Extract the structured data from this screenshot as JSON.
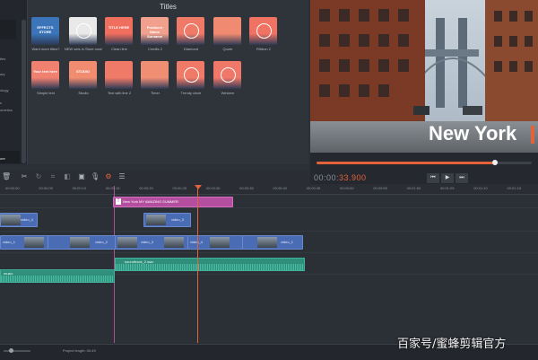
{
  "titles_panel": {
    "header": "Titles",
    "tiles": [
      {
        "label": "Want more titles?",
        "art_text": "EFFECTS STORE",
        "bg": "#3b74b8",
        "icon": "store-icon"
      },
      {
        "label": "NEW sets in Store now!",
        "art_text": "",
        "bg": "#e9e9e9",
        "icon": "badge-icon"
      },
      {
        "label": "Clean line",
        "art_text": "TITLE HERE",
        "bg": "#f06e5d",
        "icon": ""
      },
      {
        "label": "Credits 2",
        "art_text": "Producer Name Surname",
        "bg": "#f1a08e",
        "icon": ""
      },
      {
        "label": "Diamond",
        "art_text": "",
        "bg": "#f07a68",
        "icon": "diamond-icon"
      },
      {
        "label": "Quote",
        "art_text": "",
        "bg": "#f08a70",
        "icon": ""
      },
      {
        "label": "Ribbon 2",
        "art_text": "",
        "bg": "#f07262",
        "icon": "ribbon-icon"
      },
      {
        "label": "Simple text",
        "art_text": "Your text here",
        "bg": "#f08070",
        "icon": ""
      },
      {
        "label": "Studio",
        "art_text": "STUDIO",
        "bg": "#f18c70",
        "icon": ""
      },
      {
        "label": "Text with line 2",
        "art_text": "",
        "bg": "#f07a68",
        "icon": ""
      },
      {
        "label": "Timer",
        "art_text": "",
        "bg": "#f08e74",
        "icon": ""
      },
      {
        "label": "Trendy circle",
        "art_text": "",
        "bg": "#f07a68",
        "icon": "circle-icon"
      },
      {
        "label": "Western",
        "art_text": "",
        "bg": "#f07868",
        "icon": "badge-icon"
      }
    ]
  },
  "sidebar": {
    "items": [
      "tles",
      "ary",
      "ology",
      "s",
      "ometics",
      "ore"
    ]
  },
  "preview": {
    "overlay_title": "New York",
    "timecode_prefix": "00:00:",
    "timecode_accent": "33.900",
    "scrub_progress": 0.83,
    "controls": [
      "⏮",
      "▶",
      "⏭"
    ]
  },
  "ruler": {
    "ticks": [
      "00:00:00",
      "00:00:05",
      "00:00:10",
      "00:00:15",
      "00:00:20",
      "00:00:25",
      "00:00:30",
      "00:00:35",
      "00:00:40",
      "00:00:45",
      "00:00:50",
      "00:00:55",
      "00:01:00",
      "00:01:05",
      "00:01:10",
      "00:01:15"
    ]
  },
  "timeline": {
    "title_clip": "New York MY AMAZING SUMMER",
    "title_clip_tag": "T",
    "clips_track1": [
      {
        "label": "video_4"
      },
      {
        "label": "video_3"
      }
    ],
    "clips_track2": [
      {
        "label": "video_1"
      },
      {
        "label": "video_2"
      },
      {
        "label": "video_3"
      },
      {
        "label": "video_4"
      },
      {
        "label": "video_1"
      }
    ],
    "audio": [
      {
        "label": "music"
      },
      {
        "label": "soundtrack_2.wav"
      }
    ]
  },
  "status": {
    "project_length": "Project length: 00:49"
  },
  "watermark": "百家号/蜜蜂剪辑官方",
  "colors": {
    "accent": "#e4623a",
    "title_clip": "#b44fa0",
    "video_clip": "#4a6cb5",
    "audio_clip": "#2f8f7a"
  }
}
